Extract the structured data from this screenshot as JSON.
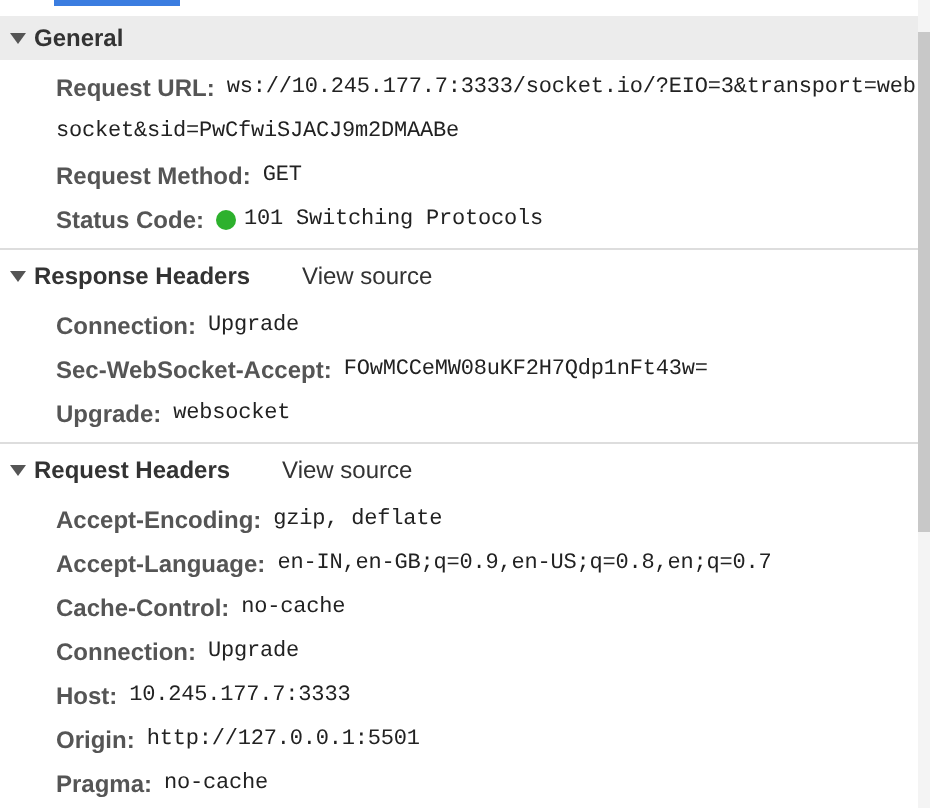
{
  "sections": [
    {
      "title": "General",
      "expanded": true,
      "shaded": true,
      "headers": [
        {
          "name": "Request URL:",
          "value": "ws://10.245.177.7:3333/socket.io/?EIO=3&transport=web",
          "continuation": "socket&sid=PwCfwiSJACJ9m2DMAABe"
        },
        {
          "name": "Request Method:",
          "value": "GET"
        },
        {
          "name": "Status Code:",
          "value": "101 Switching Protocols",
          "status_dot": true
        }
      ]
    },
    {
      "title": "Response Headers",
      "expanded": true,
      "shaded": false,
      "link": "View source",
      "headers": [
        {
          "name": "Connection:",
          "value": "Upgrade"
        },
        {
          "name": "Sec-WebSocket-Accept:",
          "value": "FOwMCCeMW08uKF2H7Qdp1nFt43w="
        },
        {
          "name": "Upgrade:",
          "value": "websocket"
        }
      ]
    },
    {
      "title": "Request Headers",
      "expanded": true,
      "shaded": false,
      "link": "View source",
      "headers": [
        {
          "name": "Accept-Encoding:",
          "value": "gzip, deflate"
        },
        {
          "name": "Accept-Language:",
          "value": "en-IN,en-GB;q=0.9,en-US;q=0.8,en;q=0.7"
        },
        {
          "name": "Cache-Control:",
          "value": "no-cache"
        },
        {
          "name": "Connection:",
          "value": "Upgrade"
        },
        {
          "name": "Host:",
          "value": "10.245.177.7:3333"
        },
        {
          "name": "Origin:",
          "value": "http://127.0.0.1:5501"
        },
        {
          "name": "Pragma:",
          "value": "no-cache"
        }
      ]
    }
  ]
}
